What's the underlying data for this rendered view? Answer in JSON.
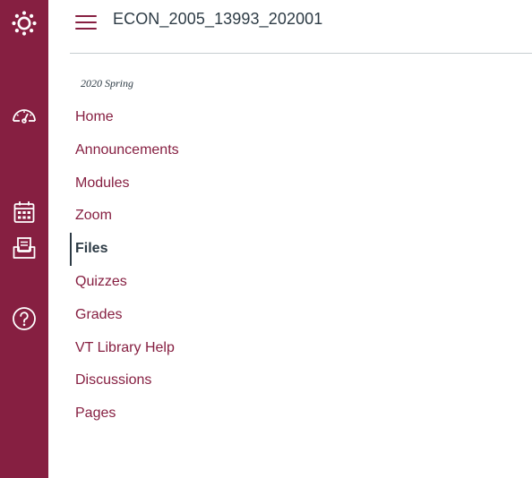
{
  "course": {
    "title": "ECON_2005_13993_202001",
    "term": "2020 Spring"
  },
  "global_nav": {
    "items": [
      {
        "icon": "logo-icon"
      },
      {
        "icon": "dashboard-icon"
      },
      {
        "icon": "calendar-icon"
      },
      {
        "icon": "inbox-icon"
      },
      {
        "icon": "help-icon"
      }
    ]
  },
  "course_nav": {
    "active": "Files",
    "items": [
      {
        "label": "Home"
      },
      {
        "label": "Announcements"
      },
      {
        "label": "Modules"
      },
      {
        "label": "Zoom"
      },
      {
        "label": "Files"
      },
      {
        "label": "Quizzes"
      },
      {
        "label": "Grades"
      },
      {
        "label": "VT Library Help"
      },
      {
        "label": "Discussions"
      },
      {
        "label": "Pages"
      }
    ]
  },
  "colors": {
    "brand": "#861F41",
    "text": "#2d3b45",
    "divider": "#c7cdd1"
  }
}
